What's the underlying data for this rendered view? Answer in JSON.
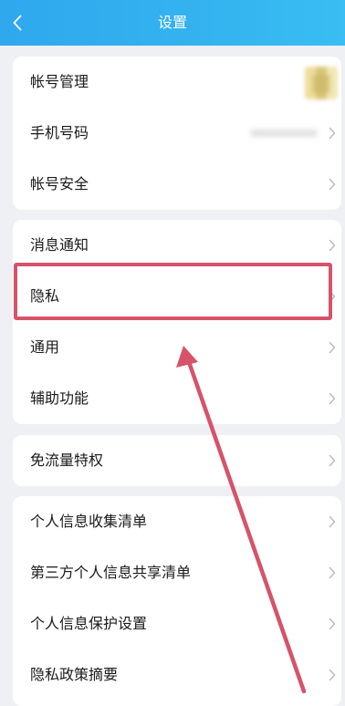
{
  "header": {
    "title": "设置",
    "background": "#33b0ef"
  },
  "groups": [
    {
      "items": [
        {
          "label": "帐号管理",
          "accessory": "avatar"
        },
        {
          "label": "手机号码",
          "accessory": "masked-value"
        },
        {
          "label": "帐号安全"
        }
      ]
    },
    {
      "items": [
        {
          "label": "消息通知"
        },
        {
          "label": "隐私",
          "highlighted": true
        },
        {
          "label": "通用"
        },
        {
          "label": "辅助功能"
        }
      ]
    },
    {
      "items": [
        {
          "label": "免流量特权"
        }
      ]
    },
    {
      "items": [
        {
          "label": "个人信息收集清单"
        },
        {
          "label": "第三方个人信息共享清单"
        },
        {
          "label": "个人信息保护设置"
        },
        {
          "label": "隐私政策摘要"
        }
      ]
    }
  ],
  "annotation": {
    "color": "#d6536a",
    "target": "隐私"
  },
  "icons": {
    "back": "chevron-left-icon",
    "row_arrow": "chevron-right-icon"
  }
}
